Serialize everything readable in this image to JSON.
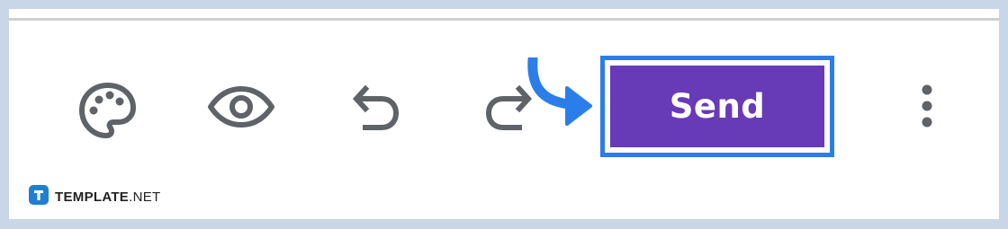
{
  "toolbar": {
    "send_label": "Send",
    "icons": [
      "palette-icon",
      "preview-eye-icon",
      "undo-icon",
      "redo-icon",
      "more-vert-icon"
    ]
  },
  "watermark": {
    "brand": "TEMPLATE",
    "suffix": ".NET"
  },
  "colors": {
    "send_background": "#673ab7",
    "highlight_border": "#2b7de9",
    "icon_gray": "#5f6368",
    "page_background": "#c9d6e8"
  }
}
